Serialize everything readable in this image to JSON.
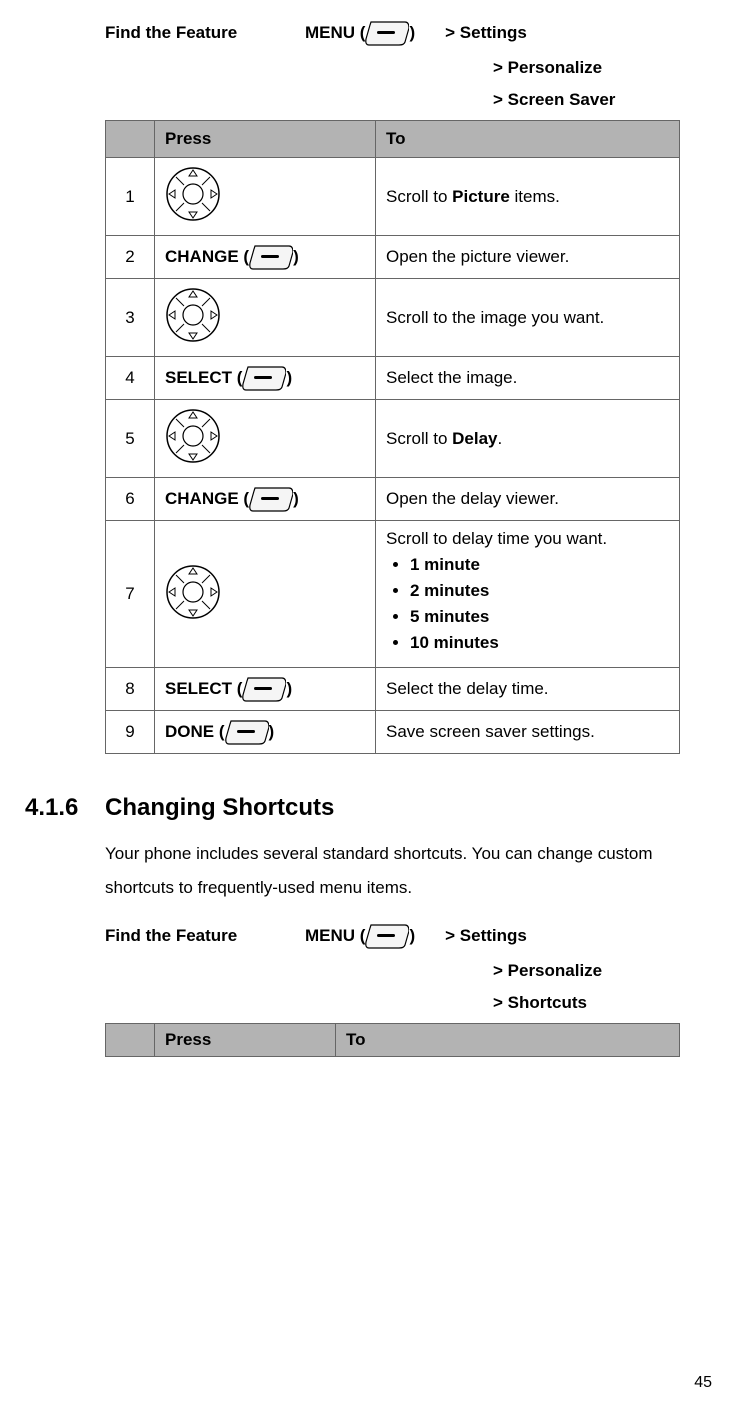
{
  "ff1": {
    "label": "Find the Feature",
    "menu_prefix": "MENU (",
    "menu_suffix": ")",
    "path1": "> Settings",
    "path2": "> Personalize",
    "path3": "> Screen Saver"
  },
  "table1": {
    "h_press": "Press",
    "h_to": "To",
    "rows": {
      "r1": {
        "n": "1",
        "to_a": "Scroll to ",
        "to_b": "Picture",
        "to_c": " items."
      },
      "r2": {
        "n": "2",
        "press_a": "CHANGE (",
        "press_b": ")",
        "to": "Open the picture viewer."
      },
      "r3": {
        "n": "3",
        "to": "Scroll to the image you want."
      },
      "r4": {
        "n": "4",
        "press_a": "SELECT (",
        "press_b": ")",
        "to": "Select the image."
      },
      "r5": {
        "n": "5",
        "to_a": "Scroll to ",
        "to_b": "Delay",
        "to_c": "."
      },
      "r6": {
        "n": "6",
        "press_a": "CHANGE (",
        "press_b": ")",
        "to": "Open the delay viewer."
      },
      "r7": {
        "n": "7",
        "to": "Scroll to delay time you want.",
        "opts": {
          "o1": "1 minute",
          "o2": "2 minutes",
          "o3": "5 minutes",
          "o4": "10 minutes"
        }
      },
      "r8": {
        "n": "8",
        "press_a": "SELECT (",
        "press_b": ")",
        "to": "Select the delay time."
      },
      "r9": {
        "n": "9",
        "press_a": "DONE (",
        "press_b": ")",
        "to": "Save screen saver settings."
      }
    }
  },
  "section": {
    "num": "4.1.6",
    "title": "Changing Shortcuts",
    "body": "Your phone includes several standard shortcuts. You can change custom shortcuts to frequently-used menu items."
  },
  "ff2": {
    "label": "Find the Feature",
    "menu_prefix": "MENU (",
    "menu_suffix": ")",
    "path1": "> Settings",
    "path2": "> Personalize",
    "path3": "> Shortcuts"
  },
  "table2": {
    "h_press": "Press",
    "h_to": "To"
  },
  "pagenum": "45"
}
